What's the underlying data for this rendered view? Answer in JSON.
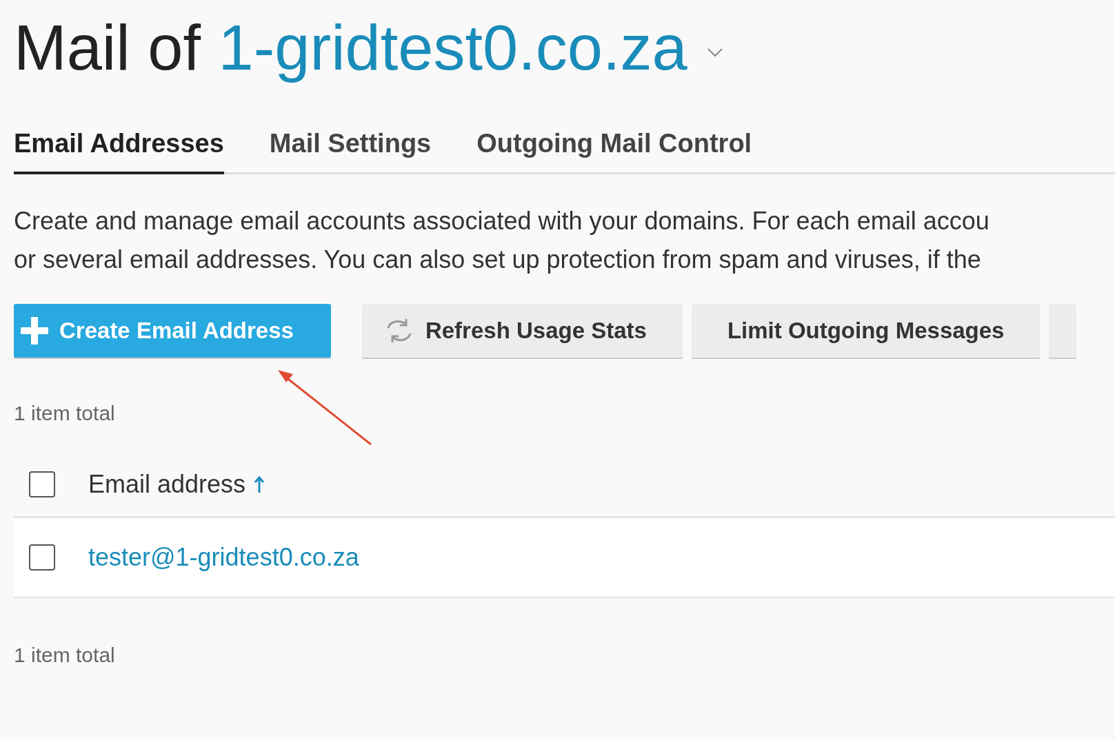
{
  "title": {
    "prefix": "Mail of",
    "domain": "1-gridtest0.co.za"
  },
  "tabs": [
    {
      "label": "Email Addresses",
      "selected": true
    },
    {
      "label": "Mail Settings",
      "selected": false
    },
    {
      "label": "Outgoing Mail Control",
      "selected": false
    }
  ],
  "description": [
    "Create and manage email accounts associated with your domains. For each email accou",
    "or several email addresses. You can also set up protection from spam and viruses, if the"
  ],
  "toolbar": [
    {
      "kind": "primary",
      "label": "Create Email Address"
    },
    {
      "kind": "refresh",
      "label": "Refresh Usage Stats"
    },
    {
      "kind": "plain",
      "label": "Limit Outgoing Messages"
    }
  ],
  "total_top": "1 item total",
  "table": {
    "columns": [
      {
        "label": "Email address",
        "sorted_ascending": true
      }
    ],
    "rows": [
      {
        "email": "tester@1-gridtest0.co.za",
        "checked": false
      }
    ],
    "select_all_checked": false
  },
  "total_bottom": "1 item total"
}
